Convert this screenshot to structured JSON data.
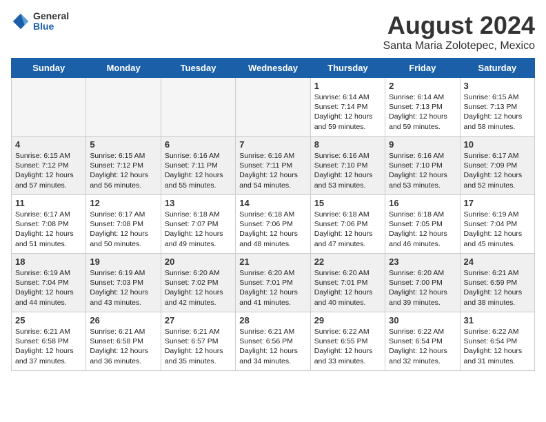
{
  "logo": {
    "general": "General",
    "blue": "Blue"
  },
  "title": "August 2024",
  "subtitle": "Santa Maria Zolotepec, Mexico",
  "headers": [
    "Sunday",
    "Monday",
    "Tuesday",
    "Wednesday",
    "Thursday",
    "Friday",
    "Saturday"
  ],
  "weeks": [
    [
      {
        "date": "",
        "text": ""
      },
      {
        "date": "",
        "text": ""
      },
      {
        "date": "",
        "text": ""
      },
      {
        "date": "",
        "text": ""
      },
      {
        "date": "1",
        "text": "Sunrise: 6:14 AM\nSunset: 7:14 PM\nDaylight: 12 hours\nand 59 minutes."
      },
      {
        "date": "2",
        "text": "Sunrise: 6:14 AM\nSunset: 7:13 PM\nDaylight: 12 hours\nand 59 minutes."
      },
      {
        "date": "3",
        "text": "Sunrise: 6:15 AM\nSunset: 7:13 PM\nDaylight: 12 hours\nand 58 minutes."
      }
    ],
    [
      {
        "date": "4",
        "text": "Sunrise: 6:15 AM\nSunset: 7:12 PM\nDaylight: 12 hours\nand 57 minutes."
      },
      {
        "date": "5",
        "text": "Sunrise: 6:15 AM\nSunset: 7:12 PM\nDaylight: 12 hours\nand 56 minutes."
      },
      {
        "date": "6",
        "text": "Sunrise: 6:16 AM\nSunset: 7:11 PM\nDaylight: 12 hours\nand 55 minutes."
      },
      {
        "date": "7",
        "text": "Sunrise: 6:16 AM\nSunset: 7:11 PM\nDaylight: 12 hours\nand 54 minutes."
      },
      {
        "date": "8",
        "text": "Sunrise: 6:16 AM\nSunset: 7:10 PM\nDaylight: 12 hours\nand 53 minutes."
      },
      {
        "date": "9",
        "text": "Sunrise: 6:16 AM\nSunset: 7:10 PM\nDaylight: 12 hours\nand 53 minutes."
      },
      {
        "date": "10",
        "text": "Sunrise: 6:17 AM\nSunset: 7:09 PM\nDaylight: 12 hours\nand 52 minutes."
      }
    ],
    [
      {
        "date": "11",
        "text": "Sunrise: 6:17 AM\nSunset: 7:08 PM\nDaylight: 12 hours\nand 51 minutes."
      },
      {
        "date": "12",
        "text": "Sunrise: 6:17 AM\nSunset: 7:08 PM\nDaylight: 12 hours\nand 50 minutes."
      },
      {
        "date": "13",
        "text": "Sunrise: 6:18 AM\nSunset: 7:07 PM\nDaylight: 12 hours\nand 49 minutes."
      },
      {
        "date": "14",
        "text": "Sunrise: 6:18 AM\nSunset: 7:06 PM\nDaylight: 12 hours\nand 48 minutes."
      },
      {
        "date": "15",
        "text": "Sunrise: 6:18 AM\nSunset: 7:06 PM\nDaylight: 12 hours\nand 47 minutes."
      },
      {
        "date": "16",
        "text": "Sunrise: 6:18 AM\nSunset: 7:05 PM\nDaylight: 12 hours\nand 46 minutes."
      },
      {
        "date": "17",
        "text": "Sunrise: 6:19 AM\nSunset: 7:04 PM\nDaylight: 12 hours\nand 45 minutes."
      }
    ],
    [
      {
        "date": "18",
        "text": "Sunrise: 6:19 AM\nSunset: 7:04 PM\nDaylight: 12 hours\nand 44 minutes."
      },
      {
        "date": "19",
        "text": "Sunrise: 6:19 AM\nSunset: 7:03 PM\nDaylight: 12 hours\nand 43 minutes."
      },
      {
        "date": "20",
        "text": "Sunrise: 6:20 AM\nSunset: 7:02 PM\nDaylight: 12 hours\nand 42 minutes."
      },
      {
        "date": "21",
        "text": "Sunrise: 6:20 AM\nSunset: 7:01 PM\nDaylight: 12 hours\nand 41 minutes."
      },
      {
        "date": "22",
        "text": "Sunrise: 6:20 AM\nSunset: 7:01 PM\nDaylight: 12 hours\nand 40 minutes."
      },
      {
        "date": "23",
        "text": "Sunrise: 6:20 AM\nSunset: 7:00 PM\nDaylight: 12 hours\nand 39 minutes."
      },
      {
        "date": "24",
        "text": "Sunrise: 6:21 AM\nSunset: 6:59 PM\nDaylight: 12 hours\nand 38 minutes."
      }
    ],
    [
      {
        "date": "25",
        "text": "Sunrise: 6:21 AM\nSunset: 6:58 PM\nDaylight: 12 hours\nand 37 minutes."
      },
      {
        "date": "26",
        "text": "Sunrise: 6:21 AM\nSunset: 6:58 PM\nDaylight: 12 hours\nand 36 minutes."
      },
      {
        "date": "27",
        "text": "Sunrise: 6:21 AM\nSunset: 6:57 PM\nDaylight: 12 hours\nand 35 minutes."
      },
      {
        "date": "28",
        "text": "Sunrise: 6:21 AM\nSunset: 6:56 PM\nDaylight: 12 hours\nand 34 minutes."
      },
      {
        "date": "29",
        "text": "Sunrise: 6:22 AM\nSunset: 6:55 PM\nDaylight: 12 hours\nand 33 minutes."
      },
      {
        "date": "30",
        "text": "Sunrise: 6:22 AM\nSunset: 6:54 PM\nDaylight: 12 hours\nand 32 minutes."
      },
      {
        "date": "31",
        "text": "Sunrise: 6:22 AM\nSunset: 6:54 PM\nDaylight: 12 hours\nand 31 minutes."
      }
    ]
  ]
}
